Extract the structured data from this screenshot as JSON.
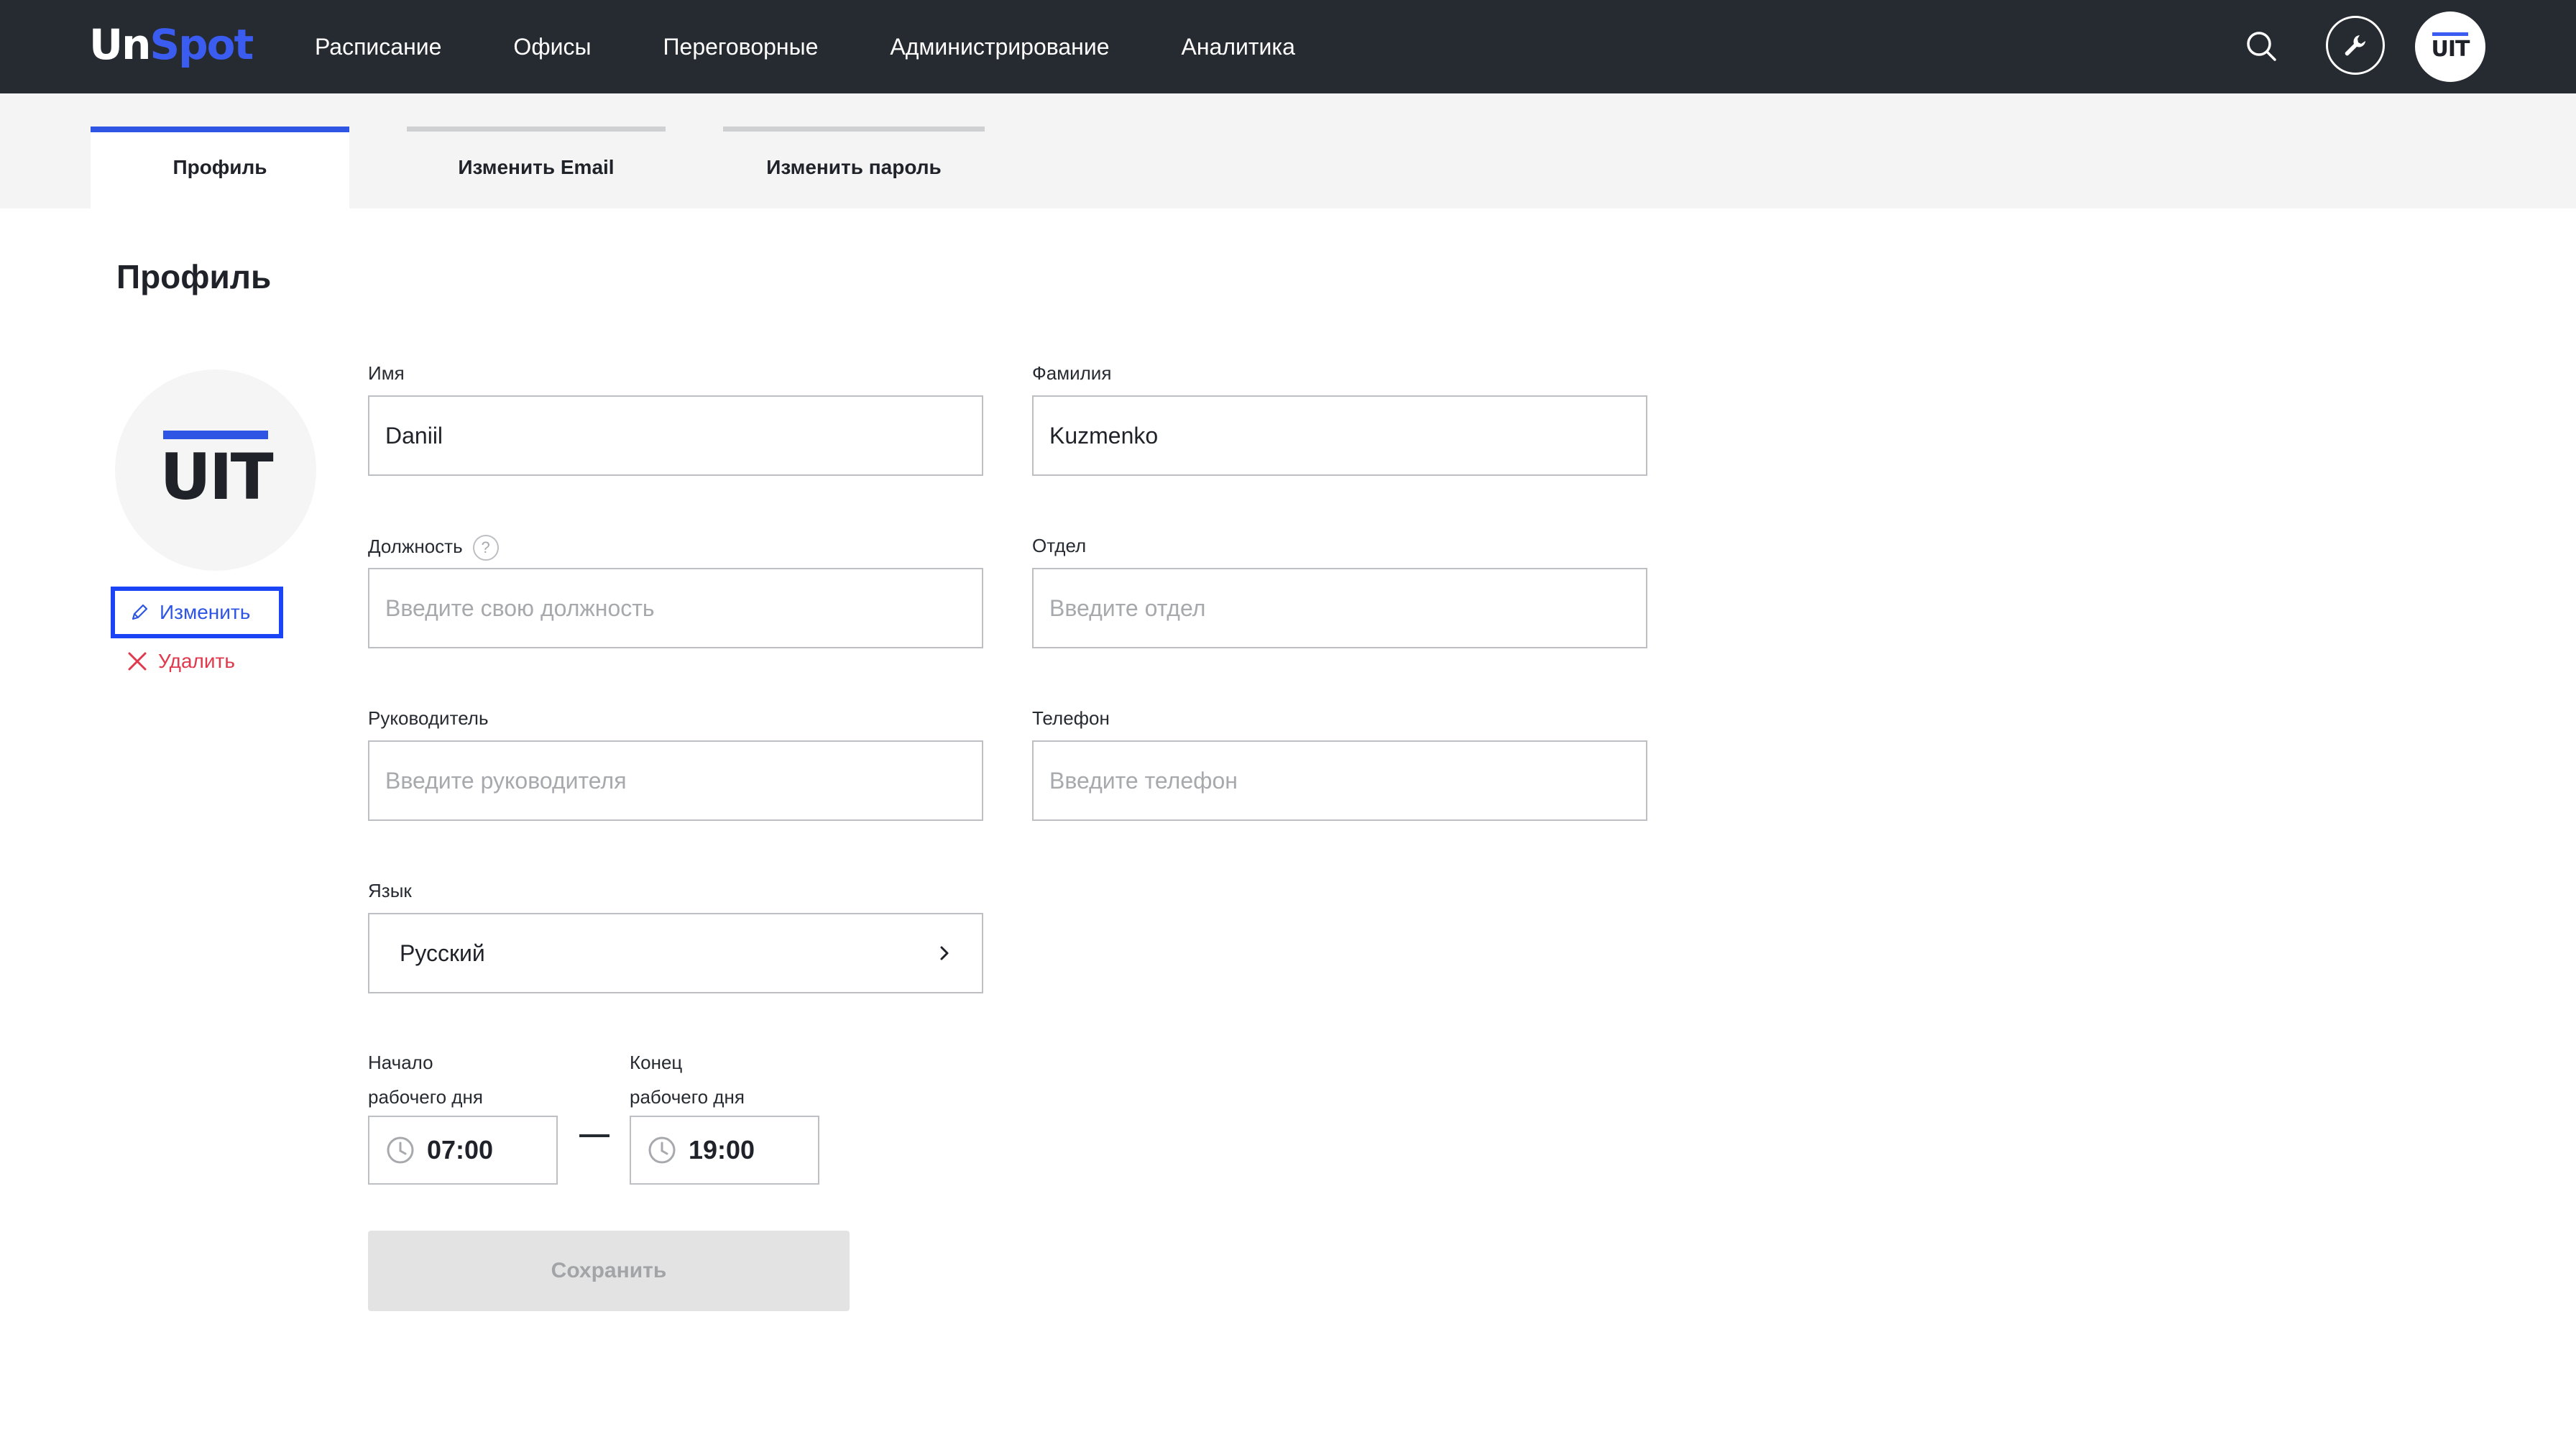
{
  "app": {
    "logo_part1": "Un",
    "logo_part2": "Spot",
    "brand_color": "#3a5cf0",
    "nav": [
      {
        "label": "Расписание"
      },
      {
        "label": "Офисы"
      },
      {
        "label": "Переговорные"
      },
      {
        "label": "Администрирование"
      },
      {
        "label": "Аналитика"
      }
    ],
    "header_icons": [
      "search-icon",
      "wrench-icon",
      "uit-avatar"
    ],
    "avatar_text": "UIT"
  },
  "tabs": [
    {
      "label": "Профиль",
      "active": true
    },
    {
      "label": "Изменить Email",
      "active": false
    },
    {
      "label": "Изменить пароль",
      "active": false
    }
  ],
  "profile": {
    "title": "Профиль",
    "avatar_text": "UIT",
    "change_label": "Изменить",
    "delete_label": "Удалить",
    "delete_color": "#e0384c"
  },
  "form": {
    "first_name": {
      "label": "Имя",
      "value": "Daniil"
    },
    "last_name": {
      "label": "Фамилия",
      "value": "Kuzmenko"
    },
    "position": {
      "label": "Должность",
      "help": "?",
      "placeholder": "Введите свою должность"
    },
    "department": {
      "label": "Отдел",
      "placeholder": "Введите отдел"
    },
    "manager": {
      "label": "Руководитель",
      "placeholder": "Введите руководителя"
    },
    "phone": {
      "label": "Телефон",
      "placeholder": "Введите телефон"
    },
    "language": {
      "label": "Язык",
      "value": "Русский"
    },
    "work_start": {
      "label_line1": "Начало",
      "label_line2": "рабочего дня",
      "value": "07:00"
    },
    "work_end": {
      "label_line1": "Конец",
      "label_line2": "рабочего дня",
      "value": "19:00"
    },
    "save_label": "Сохранить"
  }
}
